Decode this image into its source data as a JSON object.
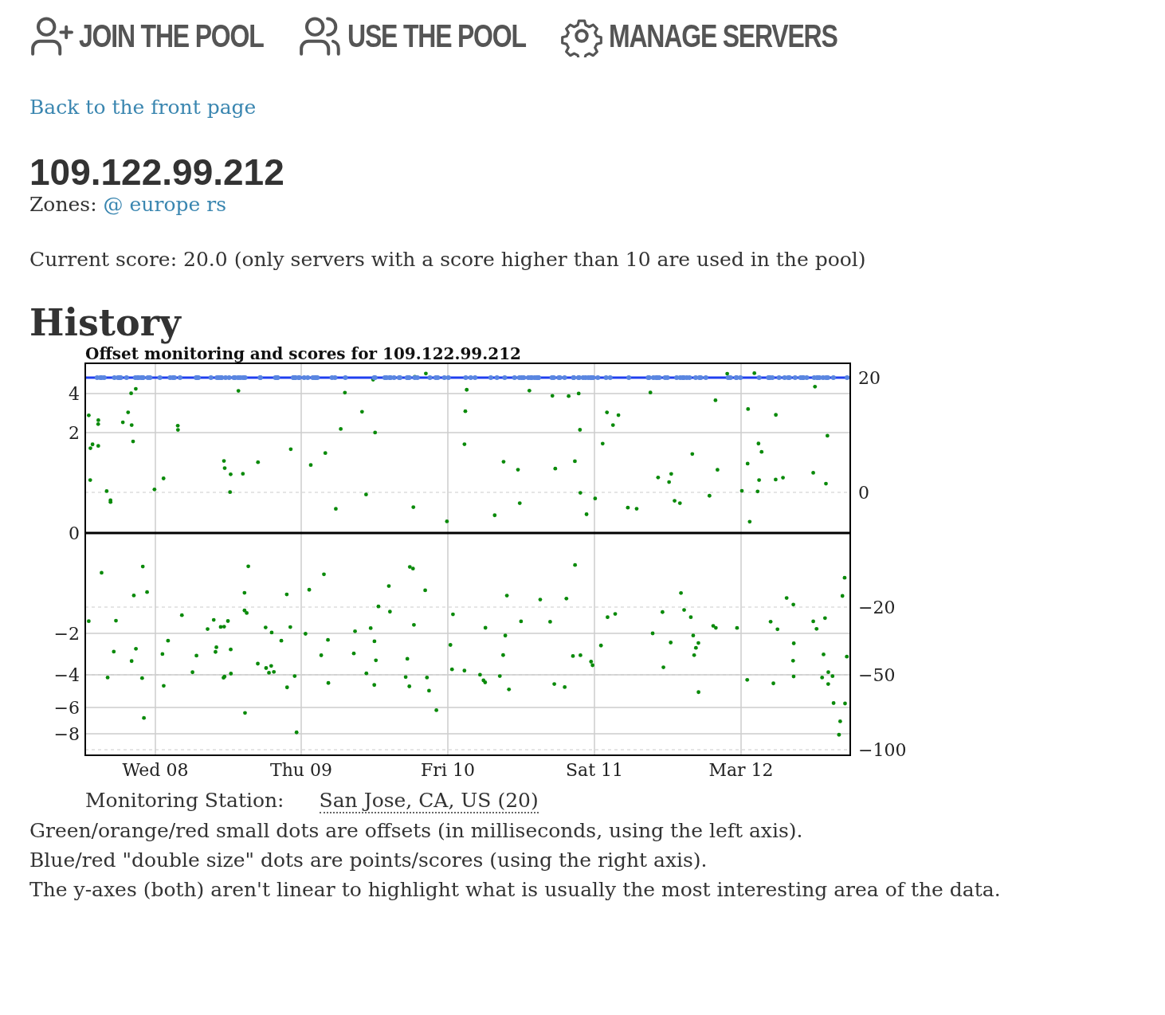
{
  "nav": [
    {
      "label": "JOIN THE POOL"
    },
    {
      "label": "USE THE POOL"
    },
    {
      "label": "MANAGE SERVERS"
    }
  ],
  "back_link": "Back to the front page",
  "server": {
    "title": "109.122.99.212",
    "zones_label": "Zones:",
    "zones": [
      "@",
      "europe",
      "rs"
    ],
    "score_text": "Current score: 20.0 (only servers with a score higher than 10 are used in the pool)"
  },
  "history": {
    "heading": "History",
    "chart_title": "Offset monitoring and scores for 109.122.99.212",
    "left_ticks": [
      "4",
      "2",
      "0",
      "−2",
      "−4",
      "−6",
      "−8"
    ],
    "right_ticks": [
      "20",
      "0",
      "−20",
      "−50",
      "−100"
    ],
    "x_ticks": [
      "Wed 08",
      "Thu 09",
      "Fri 10",
      "Sat 11",
      "Mar 12"
    ],
    "station_label": "Monitoring Station:",
    "station": "San Jose, CA, US (20)",
    "notes": [
      "Green/orange/red small dots are offsets (in milliseconds, using the left axis).",
      "Blue/red \"double size\" dots are points/scores (using the right axis).",
      "The y-axes (both) aren't linear to highlight what is usually the most interesting area of the data."
    ]
  }
}
